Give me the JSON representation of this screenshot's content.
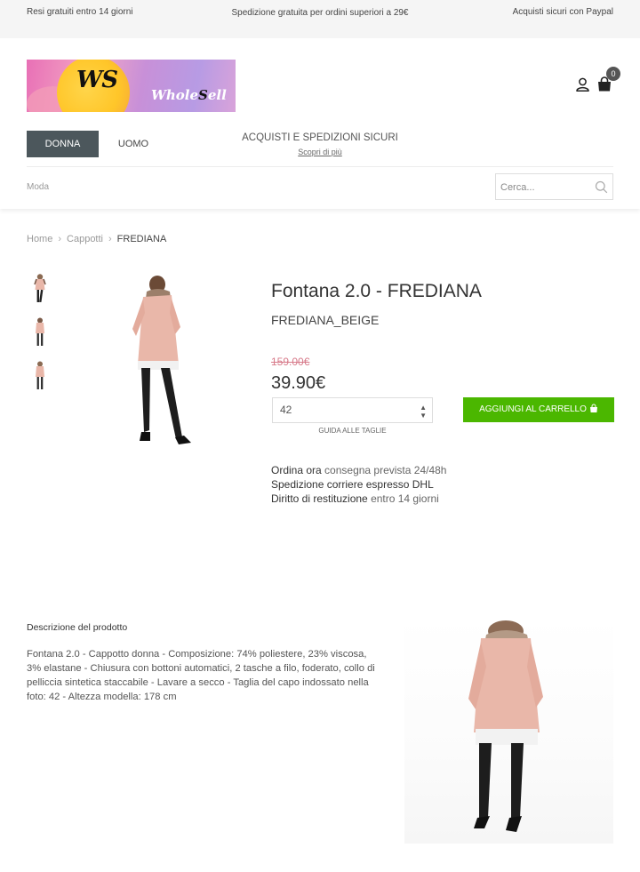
{
  "topbar": {
    "left": "Resi gratuiti entro 14 giorni",
    "center": "Spedizione gratuita per ordini superiori a 29€",
    "right": "Acquisti sicuri con Paypal"
  },
  "logo": {
    "mark": "WS",
    "word_part1": "Whole",
    "word_s": "S",
    "word_part2": "ell"
  },
  "cart": {
    "count": "0"
  },
  "nav": {
    "donna": "DONNA",
    "uomo": "UOMO"
  },
  "promo": {
    "title": "ACQUISTI E SPEDIZIONI SICURI",
    "link": "Scopri di più"
  },
  "category": "Moda",
  "search": {
    "placeholder": "Cerca..."
  },
  "breadcrumb": {
    "home": "Home",
    "category": "Cappotti",
    "current": "FREDIANA"
  },
  "product": {
    "title": "Fontana 2.0 - FREDIANA",
    "code": "FREDIANA_BEIGE",
    "old_price": "159.00€",
    "price": "39.90€",
    "size": "42",
    "size_guide": "GUIDA ALLE TAGLIE",
    "add_to_cart": "AGGIUNGI AL CARRELLO"
  },
  "shipping": {
    "line1_bold": "Ordina ora",
    "line1_rest": "consegna prevista 24/48h",
    "line2": "Spedizione corriere espresso DHL",
    "line3_bold": "Diritto di restituzione",
    "line3_rest": "entro 14 giorni"
  },
  "description": {
    "title": "Descrizione del prodotto",
    "body": "Fontana 2.0 - Cappotto donna - Composizione: 74% poliestere, 23% viscosa, 3% elastane - Chiusura con bottoni automatici, 2 tasche a filo, foderato, collo di pelliccia sintetica staccabile - Lavare a secco - Taglia del capo indossato nella foto: 42 - Altezza modella: 178 cm"
  },
  "colors": {
    "nav_active_bg": "#4c575c",
    "add_to_cart_bg": "#4bb700",
    "old_price": "#d77a8a",
    "coat": "#e9b7a9"
  }
}
